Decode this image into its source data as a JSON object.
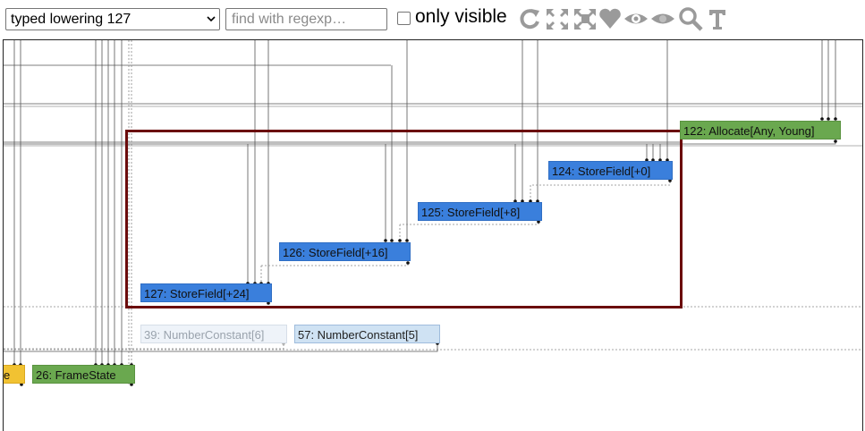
{
  "toolbar": {
    "phase_select_value": "typed lowering 127",
    "search_placeholder": "find with regexp…",
    "only_visible_label": "only visible",
    "icons": [
      "relayout-icon",
      "show-all-icon",
      "toggle-hide-dead-icon",
      "show-type-icon",
      "hide-unselected-icon",
      "hide-selected-icon",
      "zoom-selection-icon",
      "toggle-types-icon"
    ]
  },
  "nodes": [
    {
      "id": "n122",
      "label": "122: Allocate[Any, Young]",
      "color": "green"
    },
    {
      "id": "n124",
      "label": "124: StoreField[+0]",
      "color": "blue"
    },
    {
      "id": "n125",
      "label": "125: StoreField[+8]",
      "color": "blue"
    },
    {
      "id": "n126",
      "label": "126: StoreField[+16]",
      "color": "blue"
    },
    {
      "id": "n127",
      "label": "127: StoreField[+24]",
      "color": "blue"
    },
    {
      "id": "n39",
      "label": "39: NumberConstant[6]",
      "color": "faded"
    },
    {
      "id": "n57",
      "label": "57: NumberConstant[5]",
      "color": "light"
    },
    {
      "id": "n26",
      "label": "26: FrameState",
      "color": "green"
    },
    {
      "id": "nleft",
      "label": "e",
      "color": "yellow"
    }
  ],
  "colors": {
    "store_field": "#3a7fdc",
    "allocate": "#6aa84f",
    "frame_state": "#6aa84f",
    "partial": "#f1c232",
    "constant": "#cfe2f3",
    "selection_border": "#6b0b0b"
  }
}
